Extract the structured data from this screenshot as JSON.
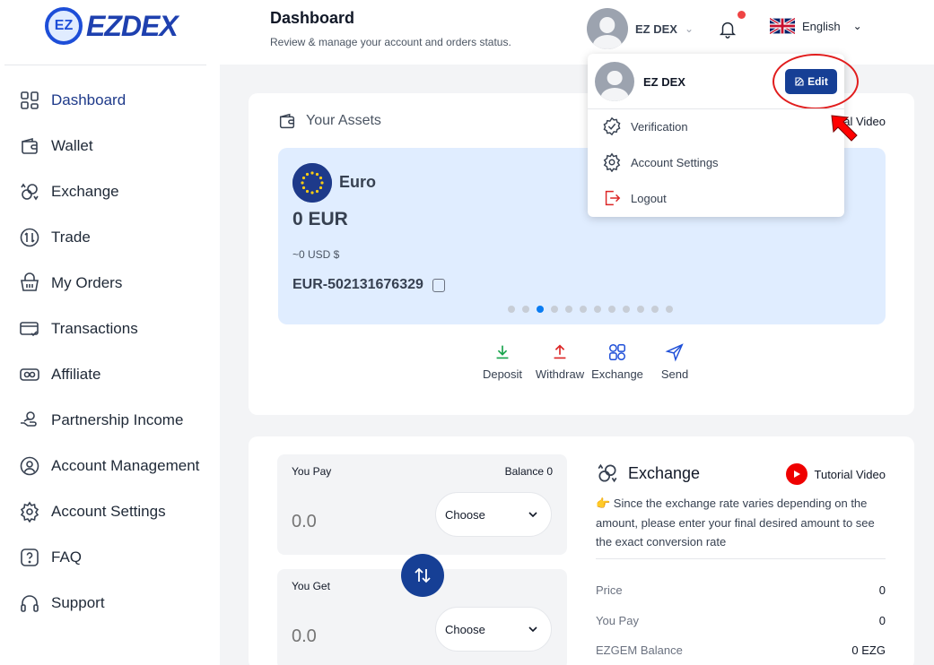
{
  "logo": {
    "badge": "EZ",
    "text": "EZDEX"
  },
  "sidebar": {
    "items": [
      {
        "label": "Dashboard",
        "icon": "dashboard-grid-icon",
        "active": true
      },
      {
        "label": "Wallet",
        "icon": "wallet-icon"
      },
      {
        "label": "Exchange",
        "icon": "exchange-coins-icon"
      },
      {
        "label": "Trade",
        "icon": "trade-icon"
      },
      {
        "label": "My Orders",
        "icon": "basket-icon"
      },
      {
        "label": "Transactions",
        "icon": "card-transfer-icon"
      },
      {
        "label": "Affiliate",
        "icon": "affiliate-icon"
      },
      {
        "label": "Partnership Income",
        "icon": "hand-money-icon"
      },
      {
        "label": "Account Management",
        "icon": "user-circle-icon"
      },
      {
        "label": "Account Settings",
        "icon": "gear-icon"
      },
      {
        "label": "FAQ",
        "icon": "question-icon"
      },
      {
        "label": "Support",
        "icon": "headphones-icon"
      }
    ]
  },
  "header": {
    "title": "Dashboard",
    "subtitle": "Review & manage your account and orders status.",
    "user_name": "EZ DEX",
    "language": "English"
  },
  "dropdown": {
    "name": "EZ DEX",
    "edit_label": "Edit",
    "items": [
      {
        "label": "Verification",
        "icon": "verified-badge-icon"
      },
      {
        "label": "Account Settings",
        "icon": "gear-icon"
      },
      {
        "label": "Logout",
        "icon": "logout-icon"
      }
    ]
  },
  "assets": {
    "title": "Your Assets",
    "tutorial_partial": "al Video",
    "currency_name": "Euro",
    "balance": "0 EUR",
    "balance_usd": "~0 USD $",
    "account_id": "EUR-502131676329",
    "slide_count": 12,
    "active_slide": 2,
    "actions": [
      {
        "label": "Deposit",
        "icon": "download-icon",
        "color": "#16a34a"
      },
      {
        "label": "Withdraw",
        "icon": "upload-icon",
        "color": "#dc2626"
      },
      {
        "label": "Exchange",
        "icon": "exchange-icon",
        "color": "#1d4ed8"
      },
      {
        "label": "Send",
        "icon": "send-icon",
        "color": "#1d4ed8"
      }
    ]
  },
  "exchange": {
    "pay_label": "You Pay",
    "balance_label": "Balance 0",
    "pay_placeholder": "0.0",
    "get_label": "You Get",
    "get_placeholder": "0.0",
    "choose_label": "Choose",
    "title": "Exchange",
    "tutorial_label": "Tutorial Video",
    "note": "👉 Since the exchange rate varies depending on the amount, please enter your final desired amount to see the exact conversion rate",
    "stats": [
      {
        "label": "Price",
        "value": "0"
      },
      {
        "label": "You Pay",
        "value": "0"
      },
      {
        "label": "EZGEM Balance",
        "value": "0 EZG"
      }
    ]
  },
  "colors": {
    "primary": "#163f95",
    "highlight": "#e11d1d",
    "notification": "#ef4444"
  }
}
